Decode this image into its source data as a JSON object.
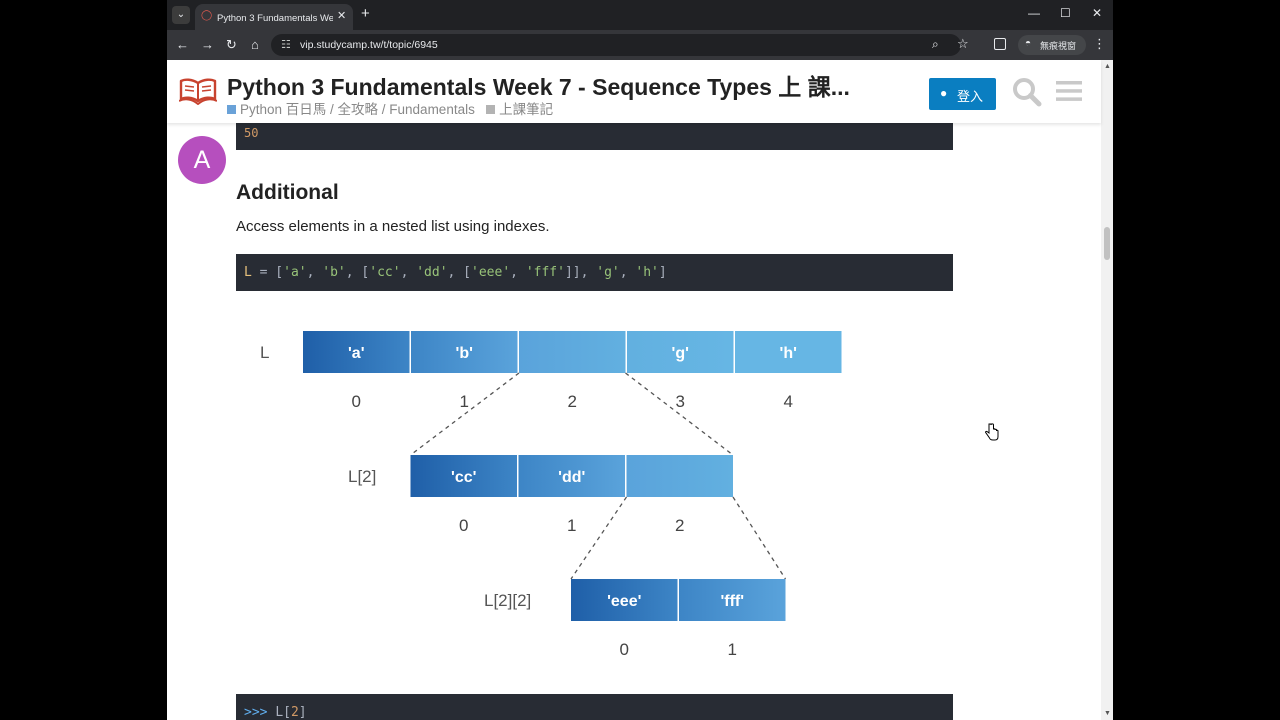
{
  "browser": {
    "tab_title": "Python 3 Fundamentals Week 7 - Sequence Types 上 課堂筆記",
    "url": "vip.studycamp.tw/t/topic/6945",
    "profile_label": "無痕視窗"
  },
  "header": {
    "title": "Python 3 Fundamentals Week 7 - Sequence Types 上 課...",
    "breadcrumbs": [
      {
        "label": "Python 百日馬 / 全攻略 / Fundamentals",
        "color": "#6aa2d8"
      },
      {
        "label": "上課筆記",
        "color": "#b3b3b3"
      }
    ],
    "login_label": "登入"
  },
  "post": {
    "avatar_letter": "A",
    "code_top": "50",
    "heading": "Additional",
    "paragraph": "Access elements in a nested list using indexes.",
    "code_mid": [
      {
        "t": "L",
        "c": "#e5c07b"
      },
      {
        "t": " = [",
        "c": "#abb2bf"
      },
      {
        "t": "'a'",
        "c": "#98c379"
      },
      {
        "t": ", ",
        "c": "#abb2bf"
      },
      {
        "t": "'b'",
        "c": "#98c379"
      },
      {
        "t": ", [",
        "c": "#abb2bf"
      },
      {
        "t": "'cc'",
        "c": "#98c379"
      },
      {
        "t": ", ",
        "c": "#abb2bf"
      },
      {
        "t": "'dd'",
        "c": "#98c379"
      },
      {
        "t": ", [",
        "c": "#abb2bf"
      },
      {
        "t": "'eee'",
        "c": "#98c379"
      },
      {
        "t": ", ",
        "c": "#abb2bf"
      },
      {
        "t": "'fff'",
        "c": "#98c379"
      },
      {
        "t": "]], ",
        "c": "#abb2bf"
      },
      {
        "t": "'g'",
        "c": "#98c379"
      },
      {
        "t": ", ",
        "c": "#abb2bf"
      },
      {
        "t": "'h'",
        "c": "#98c379"
      },
      {
        "t": "]",
        "c": "#abb2bf"
      }
    ],
    "code_bot": [
      {
        "t": ">>> ",
        "c": "#61afef"
      },
      {
        "t": "L[",
        "c": "#abb2bf"
      },
      {
        "t": "2",
        "c": "#d19a66"
      },
      {
        "t": "]",
        "c": "#abb2bf"
      }
    ]
  },
  "diagram": {
    "rows": [
      {
        "name": "L",
        "cells": [
          "'a'",
          "'b'",
          "",
          "'g'",
          "'h'"
        ],
        "indexes": [
          "0",
          "1",
          "2",
          "3",
          "4"
        ]
      },
      {
        "name": "L[2]",
        "cells": [
          "'cc'",
          "'dd'",
          ""
        ],
        "indexes": [
          "0",
          "1",
          "2"
        ]
      },
      {
        "name": "L[2][2]",
        "cells": [
          "'eee'",
          "'fff'"
        ],
        "indexes": [
          "0",
          "1"
        ]
      }
    ],
    "colors": [
      "#1f5fa8",
      "#3d85c6",
      "#5aa3db",
      "#62b0e0",
      "#66b6e4"
    ]
  }
}
